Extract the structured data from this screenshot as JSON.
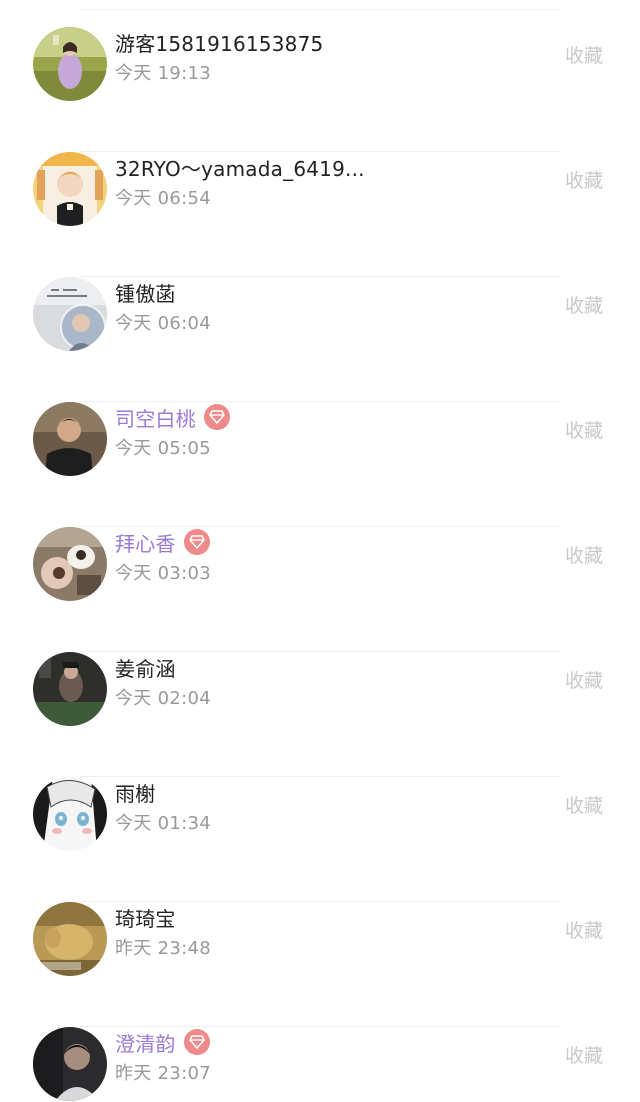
{
  "rows": [
    {
      "name": "游客1581916153875",
      "time": "今天 19:13",
      "fav": "收藏",
      "vip": false,
      "avatar_icon": "avatar-girl-field"
    },
    {
      "name": "32RYO～yamada_6419...",
      "time": "今天 06:54",
      "fav": "收藏",
      "vip": false,
      "avatar_icon": "avatar-boy-portrait"
    },
    {
      "name": "锺傲菡",
      "time": "今天 06:04",
      "fav": "收藏",
      "vip": false,
      "avatar_icon": "avatar-grey-text"
    },
    {
      "name": "司空白桃",
      "time": "今天 05:05",
      "fav": "收藏",
      "vip": true,
      "avatar_icon": "avatar-man-dark"
    },
    {
      "name": "拜心香",
      "time": "今天 03:03",
      "fav": "收藏",
      "vip": true,
      "avatar_icon": "avatar-hand-photo"
    },
    {
      "name": "姜俞涵",
      "time": "今天 02:04",
      "fav": "收藏",
      "vip": false,
      "avatar_icon": "avatar-dark-figure"
    },
    {
      "name": "雨榭",
      "time": "今天 01:34",
      "fav": "收藏",
      "vip": false,
      "avatar_icon": "avatar-anime-girl"
    },
    {
      "name": "琦琦宝",
      "time": "昨天 23:48",
      "fav": "收藏",
      "vip": false,
      "avatar_icon": "avatar-yellow-pet"
    },
    {
      "name": "澄清韵",
      "time": "昨天 23:07",
      "fav": "收藏",
      "vip": true,
      "avatar_icon": "avatar-dark-portrait"
    }
  ],
  "colors": {
    "name": "#222222",
    "vip_name": "#9b7ad6",
    "vip_badge": "#ee8a8a",
    "time": "#999999",
    "fav": "#c9c9c9",
    "divider": "#f0f0f0"
  }
}
